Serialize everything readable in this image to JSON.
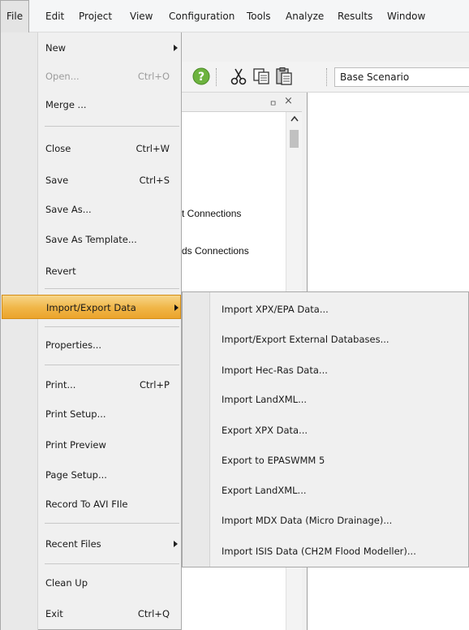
{
  "menubar": {
    "items": [
      "File",
      "Edit",
      "Project",
      "View",
      "Configuration",
      "Tools",
      "Analyze",
      "Results",
      "Window"
    ]
  },
  "toolbar": {
    "scenario": "Base Scenario",
    "icons": [
      "help-icon",
      "cut-icon",
      "copy-icon",
      "paste-icon"
    ]
  },
  "panel": {
    "pin": "ㅁ",
    "close": "×",
    "fragments": [
      "t Connections",
      "ds Connections"
    ]
  },
  "file_menu": {
    "new": "New",
    "open": "Open...",
    "open_shortcut": "Ctrl+O",
    "merge": "Merge ...",
    "close": "Close",
    "close_shortcut": "Ctrl+W",
    "save": "Save",
    "save_shortcut": "Ctrl+S",
    "save_as": "Save As...",
    "save_as_template": "Save As Template...",
    "revert": "Revert",
    "import_export": "Import/Export Data",
    "properties": "Properties...",
    "print": "Print...",
    "print_shortcut": "Ctrl+P",
    "print_setup": "Print Setup...",
    "print_preview": "Print Preview",
    "page_setup": "Page Setup...",
    "record_avi": "Record To AVI FIle",
    "recent_files": "Recent Files",
    "clean_up": "Clean Up",
    "exit": "Exit",
    "exit_shortcut": "Ctrl+Q"
  },
  "submenu": {
    "items": [
      "Import XPX/EPA Data...",
      "Import/Export External Databases...",
      "Import Hec-Ras Data...",
      "Import LandXML...",
      "Export XPX Data...",
      "Export to EPASWMM 5",
      "Export LandXML...",
      "Import MDX Data (Micro Drainage)...",
      "Import ISIS Data (CH2M Flood Modeller)..."
    ]
  },
  "colors": {
    "highlight": "#f0b546",
    "help_icon": "#6db33f"
  }
}
